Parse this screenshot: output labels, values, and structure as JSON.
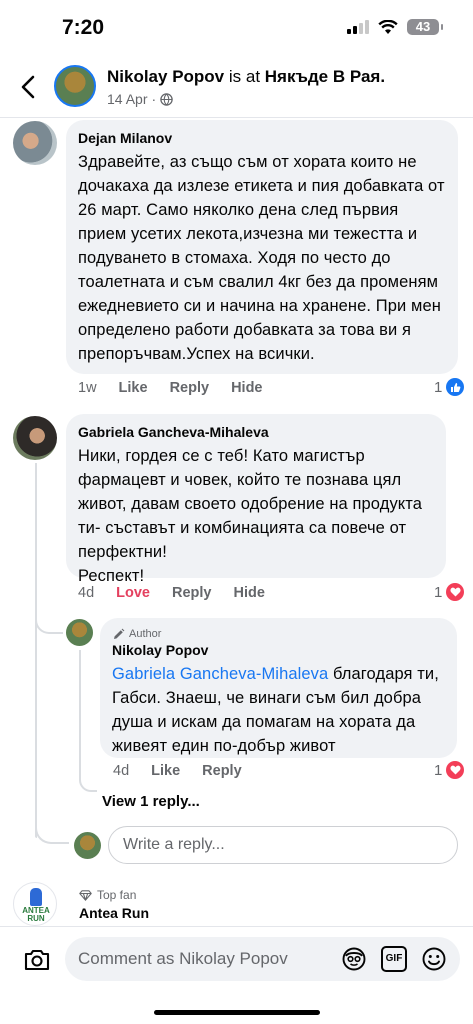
{
  "status_bar": {
    "time": "7:20",
    "battery": "43"
  },
  "header": {
    "name": "Nikolay Popov",
    "connector": " is at ",
    "place": "Някъде В Рая.",
    "date": "14 Apr",
    "privacy_icon": "globe-icon"
  },
  "comments": [
    {
      "author": "Dejan Milanov",
      "text": "Здравейте, аз също съм от хората които не дочакаха да излезе етикета и пия добавката от 26 март. Само няколко дена  след първия прием усетих лекота,изчезна ми тежестта и подуването в стомаха. Ходя по често до тоалетната и съм свалил 4кг без да променям ежедневието си и начина на хранене. При мен определено работи добавката  за това ви я препоръчвам.Успех на всички.",
      "time": "1w",
      "like": "Like",
      "reply": "Reply",
      "hide": "Hide",
      "reaction_count": "1",
      "reaction_icon": "like-icon"
    },
    {
      "author": "Gabriela Gancheva-Mihaleva",
      "text": "Ники, гордея се с теб! Като магистър фармацевт и човек, който те познава цял живот, давам своето одобрение на продукта ти- съставът и комбинацията са повече от перфектни!\nРеспект!",
      "time": "4d",
      "like": "Love",
      "reply": "Reply",
      "hide": "Hide",
      "reaction_count": "1",
      "reaction_icon": "heart-icon"
    }
  ],
  "reply": {
    "author_tag": "Author",
    "author": "Nikolay Popov",
    "mention": "Gabriela Gancheva-Mihaleva",
    "text": " благодаря ти, Габси. Знаеш, че винаги съм бил добра душа и искам да помагам на хората да живеят един по-добър живот",
    "time": "4d",
    "like": "Like",
    "reply": "Reply",
    "reaction_count": "1",
    "reaction_icon": "heart-icon"
  },
  "view_replies": "View 1 reply...",
  "reply_placeholder": "Write a reply...",
  "next_comment": {
    "badge": "Top fan",
    "author": "Antea Run",
    "avatar_text": "ANTEA RUN"
  },
  "composer": {
    "placeholder": "Comment as Nikolay Popov",
    "gif": "GIF"
  },
  "colors": {
    "link": "#1877f2",
    "love": "#e4405f",
    "bubble": "#f0f2f5"
  }
}
